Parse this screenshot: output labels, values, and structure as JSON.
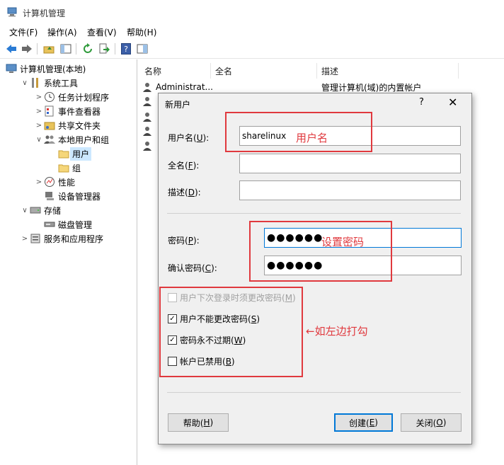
{
  "window": {
    "title": "计算机管理"
  },
  "menu": [
    "文件(F)",
    "操作(A)",
    "查看(V)",
    "帮助(H)"
  ],
  "tree": [
    {
      "label": "计算机管理(本地)",
      "indent": 0,
      "chev": "",
      "icon": "computer-icon"
    },
    {
      "label": "系统工具",
      "indent": 1,
      "chev": "∨",
      "icon": "tools-icon"
    },
    {
      "label": "任务计划程序",
      "indent": 2,
      "chev": ">",
      "icon": "clock-icon"
    },
    {
      "label": "事件查看器",
      "indent": 2,
      "chev": ">",
      "icon": "event-viewer-icon"
    },
    {
      "label": "共享文件夹",
      "indent": 2,
      "chev": ">",
      "icon": "shared-folder-icon"
    },
    {
      "label": "本地用户和组",
      "indent": 2,
      "chev": "∨",
      "icon": "users-groups-icon"
    },
    {
      "label": "用户",
      "indent": 3,
      "chev": "",
      "icon": "folder-icon",
      "selected": true
    },
    {
      "label": "组",
      "indent": 3,
      "chev": "",
      "icon": "folder-icon"
    },
    {
      "label": "性能",
      "indent": 2,
      "chev": ">",
      "icon": "performance-icon"
    },
    {
      "label": "设备管理器",
      "indent": 2,
      "chev": "",
      "icon": "device-manager-icon"
    },
    {
      "label": "存储",
      "indent": 1,
      "chev": "∨",
      "icon": "storage-icon"
    },
    {
      "label": "磁盘管理",
      "indent": 2,
      "chev": "",
      "icon": "disk-icon"
    },
    {
      "label": "服务和应用程序",
      "indent": 1,
      "chev": ">",
      "icon": "services-icon"
    }
  ],
  "list": {
    "columns": [
      "名称",
      "全名",
      "描述"
    ],
    "rows": [
      {
        "name": "Administrat...",
        "fullname": "",
        "desc": "管理计算机(域)的内置帐户"
      }
    ]
  },
  "dialog": {
    "title": "新用户",
    "help": "?",
    "close": "✕",
    "username_label": "用户名(",
    "username_key": "U",
    "fullname_label": "全名(",
    "fullname_key": "F",
    "desc_label": "描述(",
    "desc_key": "D",
    "label_close": "):",
    "username_value": "sharelinux",
    "fullname_value": "",
    "desc_value": "",
    "password_label": "密码(",
    "password_key": "P",
    "confirm_label": "确认密码(",
    "confirm_key": "C",
    "password_value": "●●●●●●",
    "confirm_value": "●●●●●●",
    "cb_must_change": "用户下次登录时须更改密码(",
    "cb_must_change_key": "M",
    "cb_cannot_change": "用户不能更改密码(",
    "cb_cannot_change_key": "S",
    "cb_never_expire": "密码永不过期(",
    "cb_never_expire_key": "W",
    "cb_disabled": "帐户已禁用(",
    "cb_disabled_key": "B",
    "paren_close": ")",
    "help_btn": "帮助(",
    "help_btn_key": "H",
    "create_btn": "创建(",
    "create_btn_key": "E",
    "close_btn": "关闭(",
    "close_btn_key": "O",
    "check_mark": "✓"
  },
  "annotations": {
    "username": "用户名",
    "password": "设置密码",
    "checkbox": "←如左边打勾"
  },
  "colors": {
    "annotation": "#e0393e",
    "focus": "#0078d7",
    "selection": "#cce8ff"
  }
}
